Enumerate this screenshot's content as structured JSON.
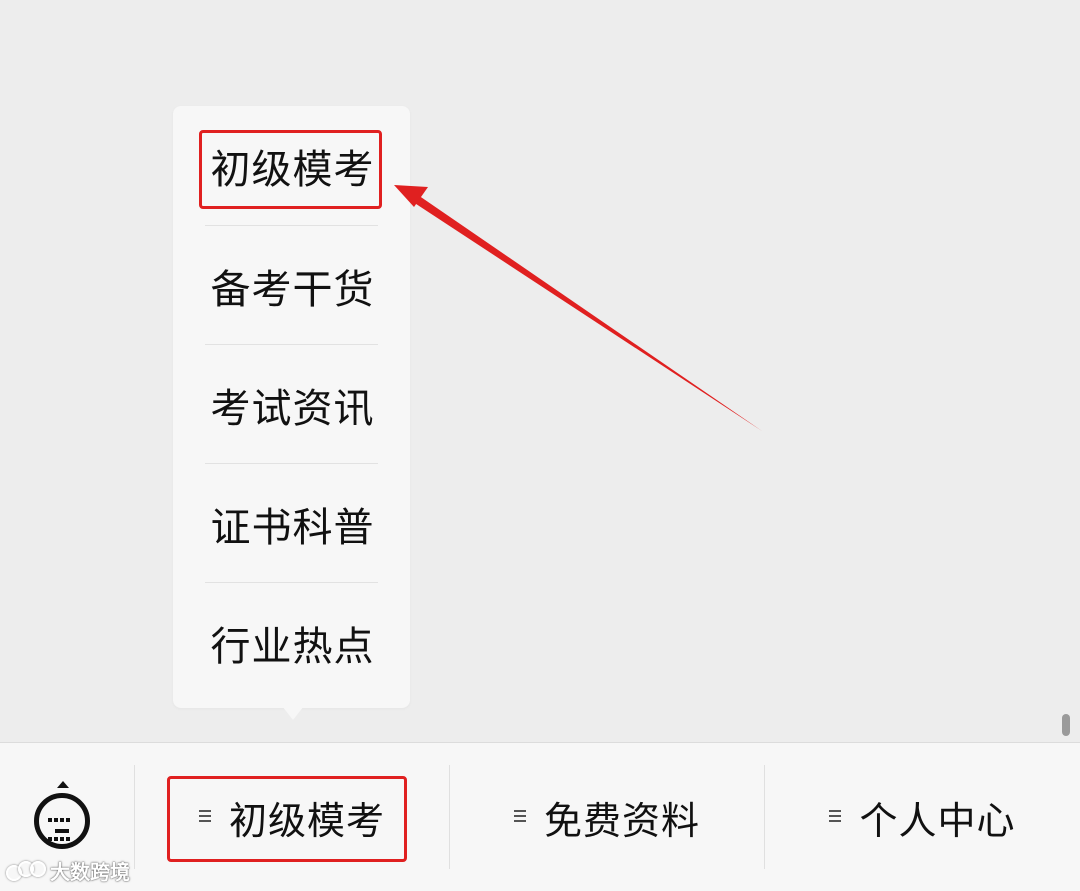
{
  "popup_menu": {
    "items": [
      {
        "label": "初级模考"
      },
      {
        "label": "备考干货"
      },
      {
        "label": "考试资讯"
      },
      {
        "label": "证书科普"
      },
      {
        "label": "行业热点"
      }
    ]
  },
  "bottom_bar": {
    "menus": [
      {
        "label": "初级模考",
        "icon": "menu-lines-icon"
      },
      {
        "label": "免费资料",
        "icon": "menu-lines-icon"
      },
      {
        "label": "个人中心",
        "icon": "menu-lines-icon"
      }
    ],
    "keyboard_icon": "keyboard-icon"
  },
  "annotation": {
    "color": "#e02020"
  },
  "watermark": {
    "text": "大数跨境"
  }
}
